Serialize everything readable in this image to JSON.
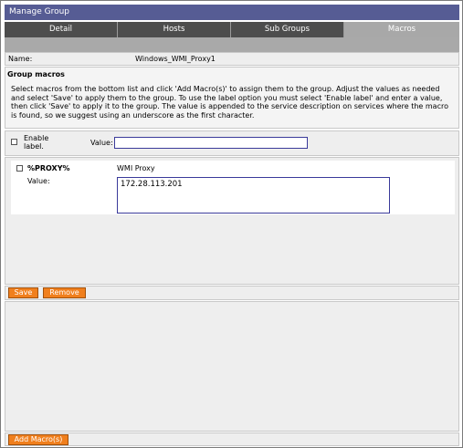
{
  "window": {
    "title": "Manage Group"
  },
  "tabs": [
    {
      "label": "Detail",
      "active": false
    },
    {
      "label": "Hosts",
      "active": false
    },
    {
      "label": "Sub Groups",
      "active": false
    },
    {
      "label": "Macros",
      "active": true
    }
  ],
  "group": {
    "name_label": "Name:",
    "name_value": "Windows_WMI_Proxy1"
  },
  "macros_section": {
    "title": "Group macros",
    "instructions": "Select macros from the bottom list and click 'Add Macro(s)' to assign them to the group. Adjust the values as needed and select 'Save' to apply them to the group. To use the label option you must select 'Enable label' and enter a value, then click 'Save' to apply it to the group. The value is appended to the service description on services where the macro is found, so we suggest using an underscore as the first character."
  },
  "label_option": {
    "enable_label": "Enable label.",
    "value_label": "Value:",
    "value": "",
    "enabled": false
  },
  "assigned_macros": [
    {
      "name": "%PROXY%",
      "description": "WMI Proxy",
      "value_label": "Value:",
      "value": "172.28.113.201",
      "checked": false
    }
  ],
  "buttons": {
    "save": "Save",
    "remove": "Remove",
    "add_macros": "Add Macro(s)"
  },
  "colors": {
    "titlebar": "#565c94",
    "tab_inactive": "#4d4d4d",
    "tab_active": "#a8a8a8",
    "button": "#f07f1d"
  }
}
